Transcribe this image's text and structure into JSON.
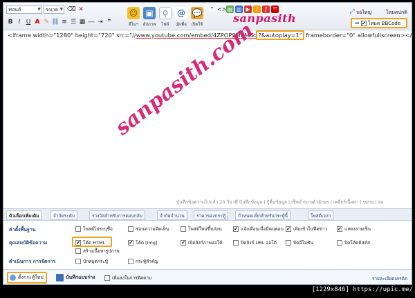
{
  "toolbar": {
    "font_select": "ฟอนต์",
    "size_select": "ขนาด",
    "format_icons": [
      "B",
      "I",
      "U",
      "A"
    ],
    "emoticon_label": "อีโมฯ",
    "upload_label": "อัปภาพ",
    "file_label": "ไฟล์",
    "mention_label": "@เพื่อ",
    "hide_label": "เปิดใช้",
    "logo_text": "sanpasith",
    "fullsize_label": "จอใหญ่",
    "normal_mode_label": "โหมดปกติ",
    "bbcode_mode_label": "โหมด BBCode",
    "bbcode_checked": "✔"
  },
  "editor": {
    "line_before": "<iframe width=\"1280\" height=\"720\" src=\"//",
    "url_text": "www.youtube.com/embed/4ZPOP9MKMAc",
    "autoplay_text": "?&autoplay=1\"",
    "line_after": " frameborder=\"0\" allowfullscreen></iframe>",
    "watermark": "sanpasith.com"
  },
  "status_line": "บันทึกข้อความไปแล้ว 20 วินาที บันทึกข้อมูล | กู้คืนข้อมูล | เช็คจำนวนตัวอักษร | เคลียร์เนื้อหา | ขยาย | ย่อ",
  "tabs": [
    "ตัวเลือกเพิ่มเติม",
    "จำกัดระดับ",
    "รางวัลสำหรับการตอบกลับ",
    "จำกัดจำนวน",
    "ราคาของกระทู้",
    "กำหนดแท็กสำหรับกระทู้นี้",
    "โพสต์เวลา"
  ],
  "options": {
    "basic_head": "ค่าตั้งพื้นฐาน",
    "props_head": "คุณสมบัติข้อความ",
    "manage_head": "ดำเนินการ การจัดการ",
    "row1": [
      {
        "label": "โพสต์ไม่ระบุชื่อ",
        "checked": ""
      },
      {
        "label": "ซ่อนความคิดเห็น",
        "checked": ""
      },
      {
        "label": "โพสต์ใหม่ขึ้นก่อน",
        "checked": ""
      },
      {
        "label": "แจ้งเตือนเมื่อมีคนตอบ",
        "checked": "✔"
      },
      {
        "label": "เพิ่มเข้าในฟีดข่าว",
        "checked": "✔"
      },
      {
        "label": "แสดงลายเซ็น",
        "checked": "✔"
      }
    ],
    "row2": [
      {
        "label": "โค้ด HTML",
        "checked": "✔"
      },
      {
        "label": "โค้ด [img]",
        "checked": "✔"
      },
      {
        "label": "เปิดลิงก์ภาพออโต้",
        "checked": "✔"
      },
      {
        "label": "ปิดลิงก์ URL ออโต้",
        "checked": ""
      },
      {
        "label": "ปิดอีโมชัน",
        "checked": ""
      },
      {
        "label": "ปิดโค้ดดิสคัส",
        "checked": ""
      }
    ],
    "row3": [
      {
        "label": "สร้างเนื้อหารูปภาพ",
        "checked": ""
      }
    ],
    "row4": [
      {
        "label": "ปักหมุดกระทู้",
        "checked": ""
      },
      {
        "label": "กระทู้สำคัญ",
        "checked": ""
      }
    ]
  },
  "bottom": {
    "settings_label": "ตั้งกระทู้ใหม่",
    "draft_label": "บันทึกแบบร่าง",
    "follow_label": "เพิ่มลงในการติดตาม",
    "detail_label": "รายละเอียดเครดิต"
  },
  "credit": "[1229x846] https://upic.me/"
}
